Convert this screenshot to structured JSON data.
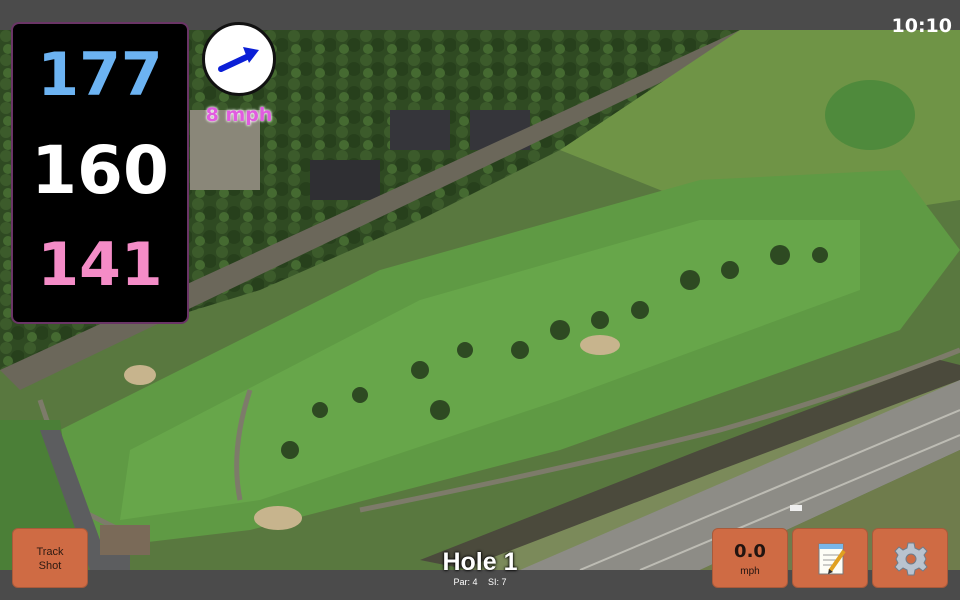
{
  "status_bar": {
    "time": "10:10"
  },
  "distances": {
    "back": "177",
    "center": "160",
    "front": "141"
  },
  "wind": {
    "speed": "8 mph",
    "direction_icon": "wind-arrow-icon"
  },
  "hole": {
    "title": "Hole 1",
    "par": "Par: 4",
    "stroke_index": "SI: 7"
  },
  "buttons": {
    "track_shot_line1": "Track",
    "track_shot_line2": "Shot",
    "speed_value": "0.0",
    "speed_unit": "mph",
    "notes_icon": "notepad-icon",
    "settings_icon": "gear-icon"
  },
  "colors": {
    "back_distance": "#6cb3f2",
    "center_distance": "#ffffff",
    "front_distance": "#f48cc7",
    "wind_speed": "#e15ce0",
    "button": "#cf6b44"
  }
}
